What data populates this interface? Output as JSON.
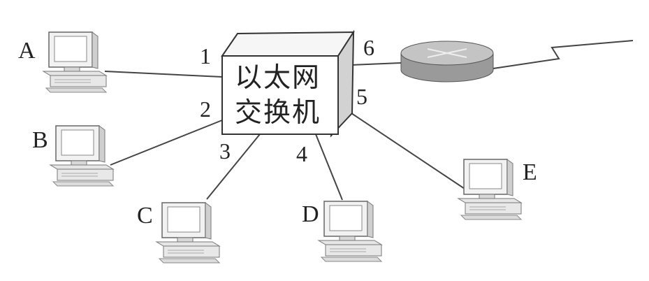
{
  "switch": {
    "line1": "以太网",
    "line2": "交换机"
  },
  "ports": {
    "p1": "1",
    "p2": "2",
    "p3": "3",
    "p4": "4",
    "p5": "5",
    "p6": "6"
  },
  "hosts": {
    "a": "A",
    "b": "B",
    "c": "C",
    "d": "D",
    "e": "E"
  }
}
